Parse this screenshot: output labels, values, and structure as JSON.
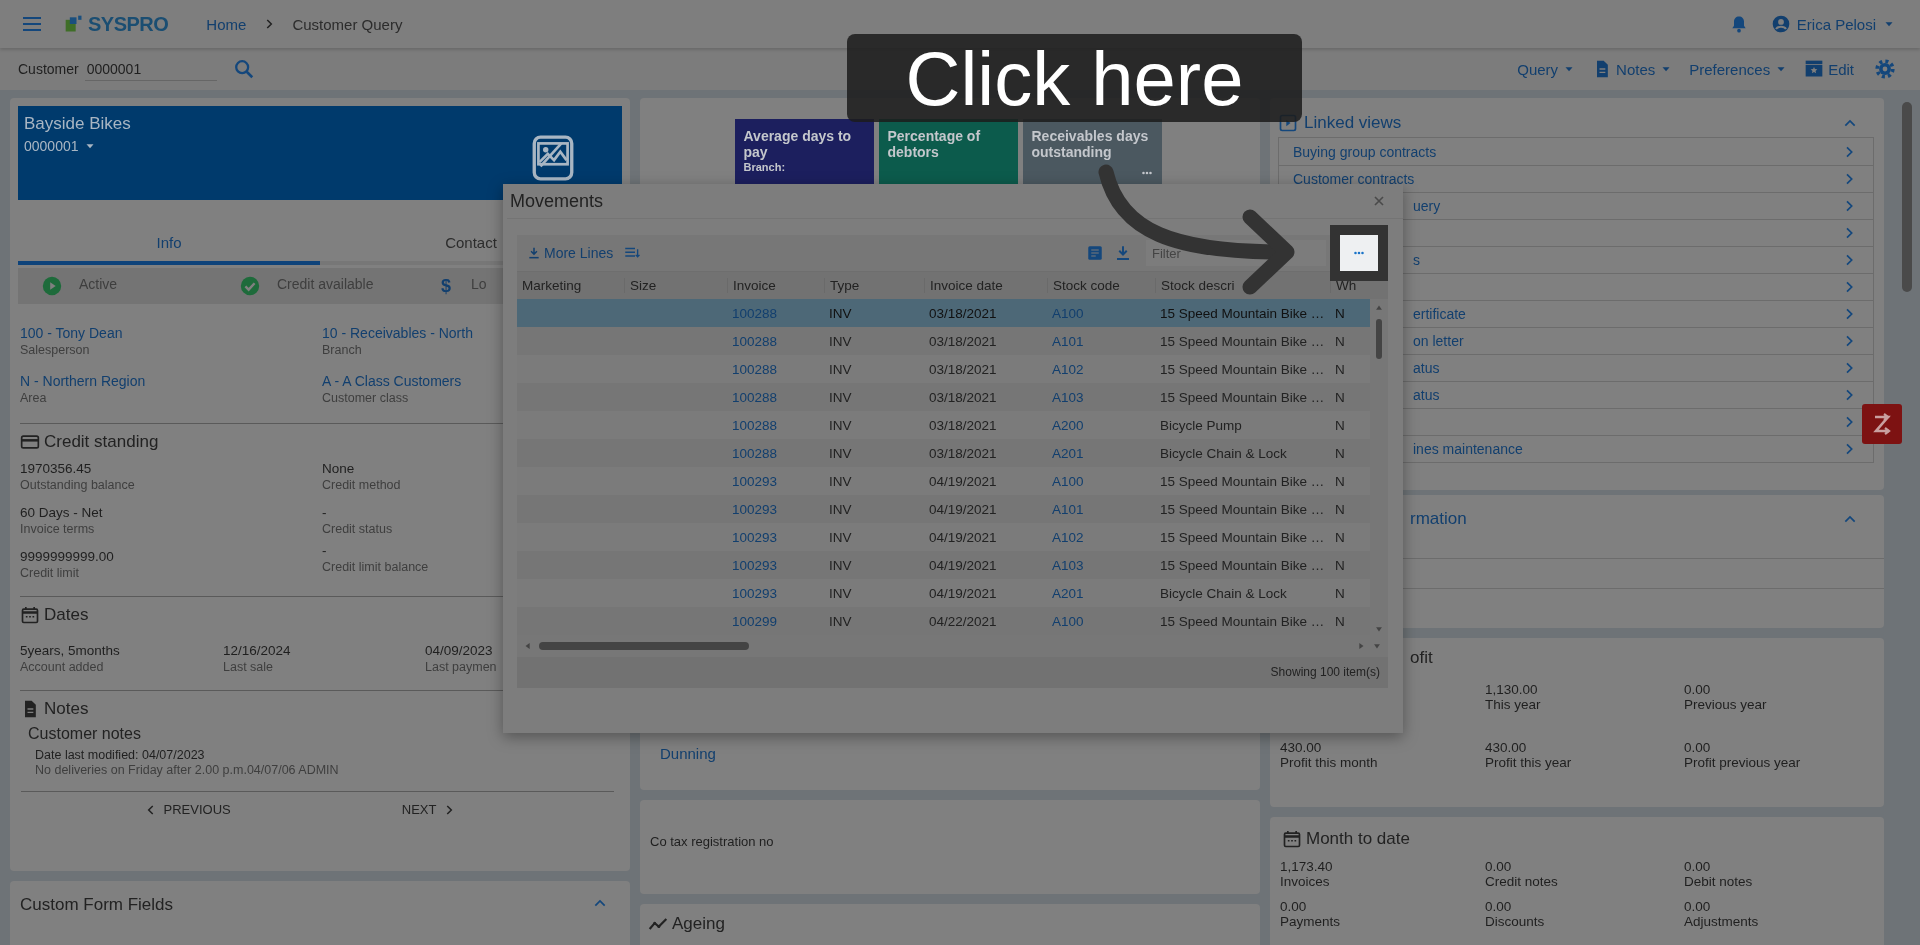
{
  "header": {
    "logo": "SYSPRO",
    "breadcrumbs": [
      {
        "label": "Home",
        "kind": "link"
      },
      {
        "label": "Customer Query",
        "kind": "current"
      }
    ],
    "user": "Erica Pelosi"
  },
  "toolbar": {
    "customer_label": "Customer",
    "customer_value": "0000001",
    "menus": [
      {
        "label": "Query",
        "kind": "dropdown"
      },
      {
        "label": "Notes",
        "kind": "notes"
      },
      {
        "label": "Preferences",
        "kind": "dropdown"
      },
      {
        "label": "Edit",
        "kind": "edit"
      }
    ]
  },
  "customer_card": {
    "name": "Bayside Bikes",
    "code": "0000001",
    "tabs": [
      {
        "label": "Info",
        "selected": true
      },
      {
        "label": "Contact",
        "selected": false
      }
    ],
    "statuses": [
      {
        "kind": "active",
        "label": "Active"
      },
      {
        "kind": "credit",
        "label": "Credit available"
      },
      {
        "kind": "currency",
        "symbol": "$",
        "label": "Lo"
      }
    ],
    "fields": [
      {
        "value": "100 - Tony Dean",
        "label": "Salesperson"
      },
      {
        "value": "10 - Receivables - North",
        "label": "Branch"
      },
      {
        "value": "N - Northern Region",
        "label": "Area"
      },
      {
        "value": "A - A Class Customers",
        "label": "Customer class"
      }
    ],
    "credit_standing": {
      "title": "Credit standing",
      "fields": [
        {
          "value": "1970356.45",
          "label": "Outstanding balance"
        },
        {
          "value": "None",
          "label": "Credit method"
        },
        {
          "value": "60 Days - Net",
          "label": "Invoice terms"
        },
        {
          "value": "-",
          "label": "Credit status"
        },
        {
          "value": "9999999999.00",
          "label": "Credit limit"
        },
        {
          "value": "-",
          "label": "Credit limit balance"
        }
      ]
    },
    "dates": {
      "title": "Dates",
      "fields": [
        {
          "value": "5years, 5months",
          "label": "Account added"
        },
        {
          "value": "12/16/2024",
          "label": "Last sale"
        },
        {
          "value": "04/09/2023",
          "label": "Last paymen"
        }
      ]
    },
    "notes": {
      "title": "Notes",
      "subtitle": "Customer notes",
      "modified": "Date last modified: 04/07/2023",
      "text": "No deliveries on Friday after 2.00 p.m.04/07/06 ADMIN"
    },
    "pager": {
      "previous": "PREVIOUS",
      "next": "NEXT"
    }
  },
  "custom_form_fields": {
    "title": "Custom Form Fields",
    "expanded": true
  },
  "middle": {
    "tiles": [
      {
        "title": "Average days to pay",
        "subtitle": "Branch:",
        "color": "#1c1f5e"
      },
      {
        "title": "Percentage of debtors",
        "color": "#0c5b4c"
      },
      {
        "title": "Receivables days outstanding",
        "color": "#4b5860"
      }
    ],
    "dunning": "Dunning",
    "tax_label": "Co tax registration no",
    "ageing_title": "Ageing"
  },
  "linked_views": {
    "title": "Linked views",
    "expanded": true,
    "items": [
      {
        "kind": "full",
        "label": "Buying group contracts"
      },
      {
        "kind": "full",
        "label": "Customer contracts"
      },
      {
        "kind": "cut",
        "label": "uery"
      },
      {
        "kind": "hidden"
      },
      {
        "kind": "cut",
        "label": "s"
      },
      {
        "kind": "hidden"
      },
      {
        "kind": "cut",
        "label": "ertificate"
      },
      {
        "kind": "cut",
        "label": "on letter"
      },
      {
        "kind": "cut",
        "label": "atus"
      },
      {
        "kind": "cut",
        "label": "atus"
      },
      {
        "kind": "hidden"
      },
      {
        "kind": "cut",
        "label": "ines maintenance"
      }
    ]
  },
  "info_card": {
    "title": "rmation",
    "expanded": true
  },
  "profit": {
    "title": "ofit",
    "stats": [
      {
        "value": "1,130.00",
        "label": "This year"
      },
      {
        "value": "0.00",
        "label": "Previous year"
      },
      {
        "value": "430.00",
        "label": "Profit this month"
      },
      {
        "value": "430.00",
        "label": "Profit this year"
      },
      {
        "value": "0.00",
        "label": "Profit previous year"
      }
    ]
  },
  "month_to_date": {
    "title": "Month to date",
    "stats": [
      {
        "value": "1,173.40",
        "label": "Invoices"
      },
      {
        "value": "0.00",
        "label": "Credit notes"
      },
      {
        "value": "0.00",
        "label": "Debit notes"
      },
      {
        "value": "0.00",
        "label": "Payments"
      },
      {
        "value": "0.00",
        "label": "Discounts"
      },
      {
        "value": "0.00",
        "label": "Adjustments"
      }
    ]
  },
  "modal": {
    "title": "Movements",
    "more_lines": "More Lines",
    "filter_placeholder": "Filter",
    "columns": [
      "Marketing",
      "Size",
      "Invoice",
      "Type",
      "Invoice date",
      "Stock code",
      "Stock descri",
      "Wh"
    ],
    "rows": [
      {
        "selected": true,
        "invoice": "100288",
        "type": "INV",
        "date": "03/18/2021",
        "stock_code": "A100",
        "description": "15 Speed Mountain Bike …",
        "wh": "N"
      },
      {
        "selected": false,
        "invoice": "100288",
        "type": "INV",
        "date": "03/18/2021",
        "stock_code": "A101",
        "description": "15 Speed Mountain Bike …",
        "wh": "N"
      },
      {
        "selected": false,
        "invoice": "100288",
        "type": "INV",
        "date": "03/18/2021",
        "stock_code": "A102",
        "description": "15 Speed Mountain Bike …",
        "wh": "N"
      },
      {
        "selected": false,
        "invoice": "100288",
        "type": "INV",
        "date": "03/18/2021",
        "stock_code": "A103",
        "description": "15 Speed Mountain Bike …",
        "wh": "N"
      },
      {
        "selected": false,
        "invoice": "100288",
        "type": "INV",
        "date": "03/18/2021",
        "stock_code": "A200",
        "description": "Bicycle Pump",
        "wh": "N"
      },
      {
        "selected": false,
        "invoice": "100288",
        "type": "INV",
        "date": "03/18/2021",
        "stock_code": "A201",
        "description": "Bicycle Chain & Lock",
        "wh": "N"
      },
      {
        "selected": false,
        "invoice": "100293",
        "type": "INV",
        "date": "04/19/2021",
        "stock_code": "A100",
        "description": "15 Speed Mountain Bike …",
        "wh": "N"
      },
      {
        "selected": false,
        "invoice": "100293",
        "type": "INV",
        "date": "04/19/2021",
        "stock_code": "A101",
        "description": "15 Speed Mountain Bike …",
        "wh": "N"
      },
      {
        "selected": false,
        "invoice": "100293",
        "type": "INV",
        "date": "04/19/2021",
        "stock_code": "A102",
        "description": "15 Speed Mountain Bike …",
        "wh": "N"
      },
      {
        "selected": false,
        "invoice": "100293",
        "type": "INV",
        "date": "04/19/2021",
        "stock_code": "A103",
        "description": "15 Speed Mountain Bike …",
        "wh": "N"
      },
      {
        "selected": false,
        "invoice": "100293",
        "type": "INV",
        "date": "04/19/2021",
        "stock_code": "A201",
        "description": "Bicycle Chain & Lock",
        "wh": "N"
      },
      {
        "selected": false,
        "invoice": "100299",
        "type": "INV",
        "date": "04/22/2021",
        "stock_code": "A100",
        "description": "15 Speed Mountain Bike …",
        "wh": "N"
      }
    ],
    "footer": "Showing 100 item(s)"
  },
  "tooltip": {
    "text": "Click here"
  }
}
